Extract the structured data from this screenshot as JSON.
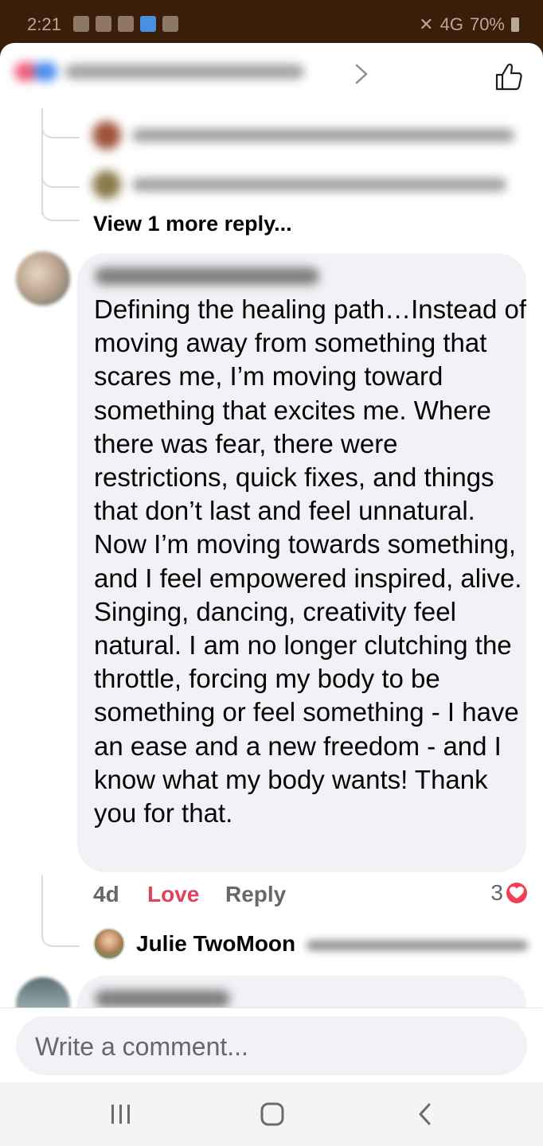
{
  "status_bar": {
    "time": "2:21",
    "battery": "70%",
    "network": "4G"
  },
  "header": {
    "reactors_hidden": true
  },
  "thread": {
    "view_more_label": "View 1 more reply..."
  },
  "comment": {
    "text": "Defining the healing path…Instead of moving away from something that scares me, I’m moving toward something that excites me. Where there was fear, there were restrictions, quick fixes, and things that don’t last and feel unnatural. Now I’m moving towards something, and I feel empowered inspired, alive. Singing, dancing, creativity feel natural. I am no longer clutching the throttle, forcing my body to be something or feel something - I have an ease and a new freedom - and I know what my body wants! Thank you for that.",
    "time": "4d",
    "love_label": "Love",
    "reply_label": "Reply",
    "reaction_count": "3"
  },
  "reply": {
    "author": "Julie TwoMoon"
  },
  "composer": {
    "placeholder": "Write a comment..."
  },
  "colors": {
    "love_red": "#e0415b",
    "bubble_gray": "#f0f2f5",
    "status_bar_brown": "#3b1e0a"
  }
}
